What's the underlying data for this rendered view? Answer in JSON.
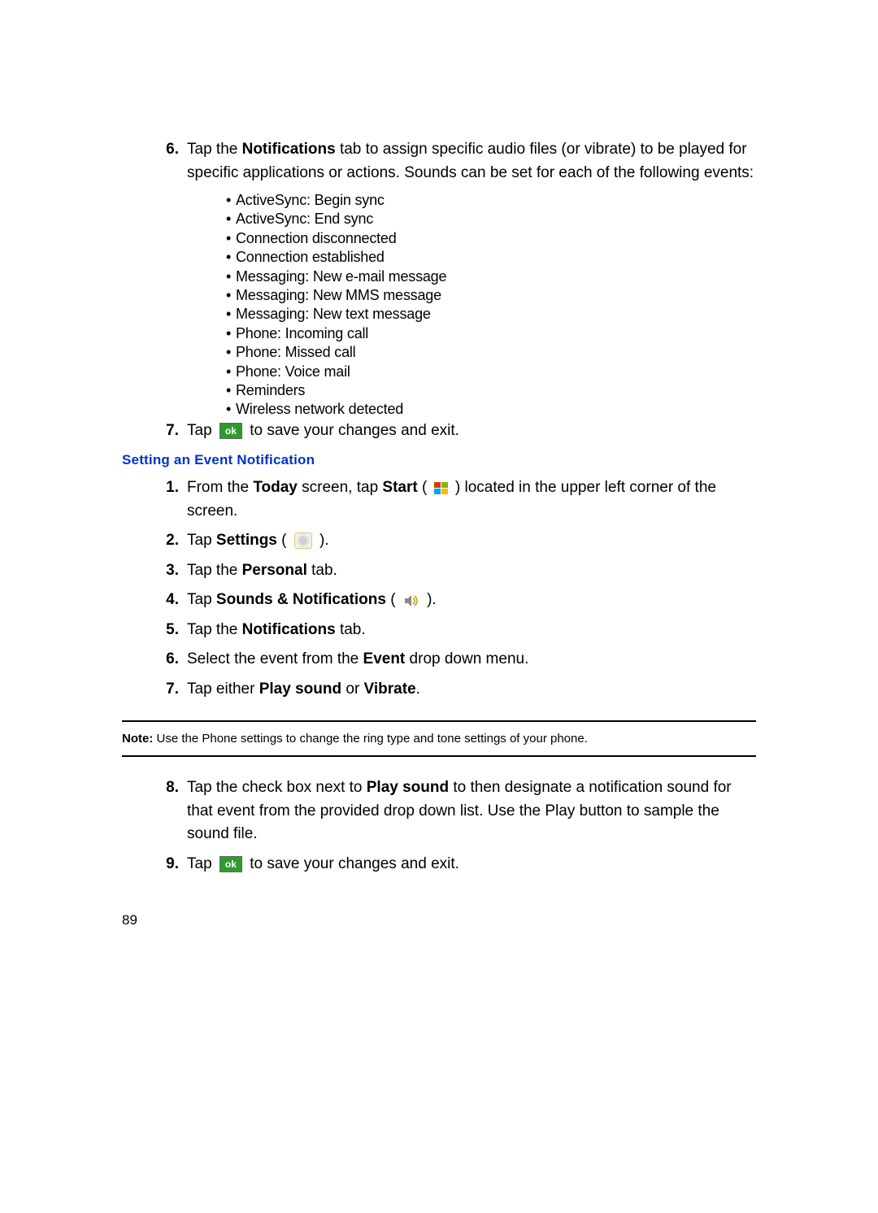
{
  "topSteps": {
    "s6": {
      "num": "6.",
      "pre": "Tap the ",
      "bold1": "Notifications",
      "mid": " tab to assign specific audio files (or vibrate) to be played for specific applications or actions. Sounds can be set for each of the following events:"
    },
    "bullets": [
      "ActiveSync: Begin sync",
      "ActiveSync: End sync",
      "Connection disconnected",
      "Connection established",
      "Messaging: New e-mail message",
      "Messaging: New MMS message",
      "Messaging: New text message",
      "Phone: Incoming call",
      "Phone: Missed call",
      "Phone: Voice mail",
      "Reminders",
      "Wireless network detected"
    ],
    "s7": {
      "num": "7.",
      "pre": "Tap ",
      "ok": "ok",
      "post": " to save your changes and exit."
    }
  },
  "sectionHeading": "Setting an Event Notification",
  "eventSteps": {
    "s1": {
      "num": "1.",
      "pre": "From the ",
      "b1": "Today",
      "mid1": " screen, tap ",
      "b2": "Start",
      "mid2": " ( ",
      "mid3": " ) located in the upper left corner of the screen."
    },
    "s2": {
      "num": "2.",
      "pre": "Tap ",
      "b1": "Settings",
      "mid1": " ( ",
      "mid2": " )."
    },
    "s3": {
      "num": "3.",
      "pre": "Tap the ",
      "b1": "Personal",
      "post": " tab."
    },
    "s4": {
      "num": "4.",
      "pre": "Tap ",
      "b1": "Sounds & Notifications",
      "mid1": " ( ",
      "mid2": " )."
    },
    "s5": {
      "num": "5.",
      "pre": "Tap the ",
      "b1": "Notifications",
      "post": " tab."
    },
    "s6": {
      "num": "6.",
      "pre": "Select the event from the ",
      "b1": "Event",
      "post": " drop down menu."
    },
    "s7": {
      "num": "7.",
      "pre": "Tap either ",
      "b1": "Play sound",
      "mid": " or ",
      "b2": "Vibrate",
      "post": "."
    }
  },
  "note": {
    "label": "Note:",
    "text": " Use the Phone settings to change the ring type and tone settings of your phone."
  },
  "afterNote": {
    "s8": {
      "num": "8.",
      "pre": "Tap the check box next to ",
      "b1": "Play sound",
      "post": " to then designate a notification sound for that event from the provided drop down list. Use the Play button to sample the sound file."
    },
    "s9": {
      "num": "9.",
      "pre": "Tap ",
      "ok": "ok",
      "post": " to save your changes and exit."
    }
  },
  "pageNumber": "89"
}
